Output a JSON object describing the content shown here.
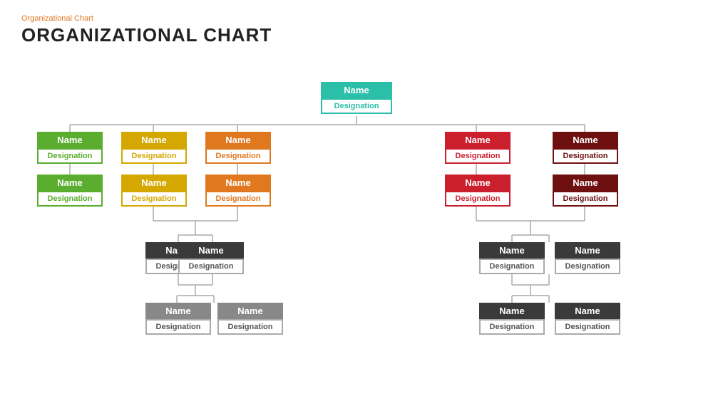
{
  "page": {
    "subtitle": "Organizational Chart",
    "title": "ORGANIZATIONAL CHART"
  },
  "nodes": {
    "top": {
      "name": "Name",
      "designation": "Designation"
    },
    "l1": [
      {
        "name": "Name",
        "designation": "Designation",
        "color": "green"
      },
      {
        "name": "Name",
        "designation": "Designation",
        "color": "yellow"
      },
      {
        "name": "Name",
        "designation": "Designation",
        "color": "orange"
      },
      {
        "name": "Name",
        "designation": "Designation",
        "color": "red"
      },
      {
        "name": "Name",
        "designation": "Designation",
        "color": "darkred"
      }
    ],
    "l2": [
      {
        "name": "Name",
        "designation": "Designation",
        "color": "green"
      },
      {
        "name": "Name",
        "designation": "Designation",
        "color": "yellow"
      },
      {
        "name": "Name",
        "designation": "Designation",
        "color": "orange"
      },
      {
        "name": "Name",
        "designation": "Designation",
        "color": "red"
      },
      {
        "name": "Name",
        "designation": "Designation",
        "color": "darkred"
      }
    ],
    "l3_left": [
      {
        "name": "Name",
        "designation": "Designation",
        "color": "darkgray"
      },
      {
        "name": "Name",
        "designation": "Designation",
        "color": "darkgray"
      }
    ],
    "l3_right": [
      {
        "name": "Name",
        "designation": "Designation",
        "color": "darkgray"
      },
      {
        "name": "Name",
        "designation": "Designation",
        "color": "darkgray"
      }
    ],
    "l4_left": [
      {
        "name": "Name",
        "designation": "Designation",
        "color": "lightgray"
      },
      {
        "name": "Name",
        "designation": "Designation",
        "color": "lightgray"
      }
    ],
    "l4_right": [
      {
        "name": "Name",
        "designation": "Designation",
        "color": "darkgray"
      },
      {
        "name": "Name",
        "designation": "Designation",
        "color": "darkgray"
      }
    ]
  }
}
